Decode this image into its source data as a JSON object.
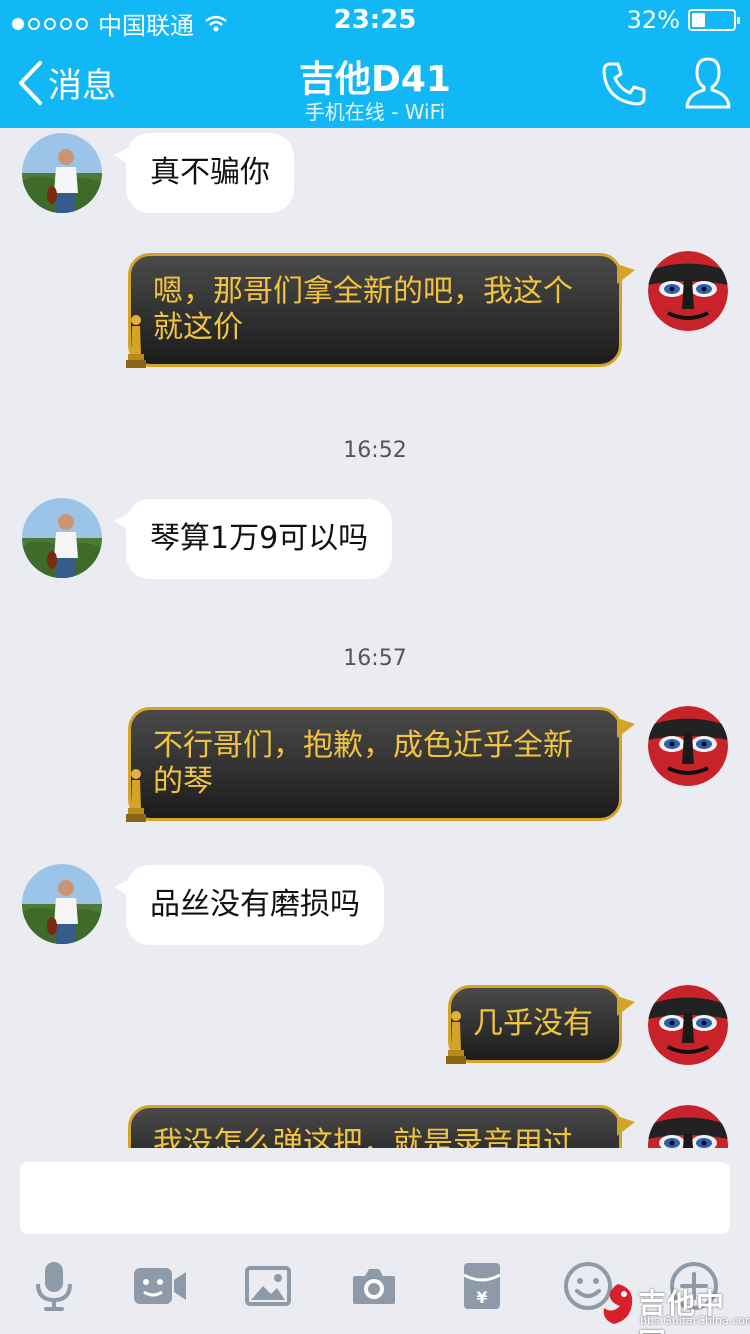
{
  "status_bar": {
    "carrier": "中国联通",
    "time": "23:25",
    "battery": "32%",
    "battery_level": 0.32,
    "signal_dots": 5,
    "signal_filled": 1
  },
  "header": {
    "back_label": "消息",
    "title": "吉他D41",
    "subtitle": "手机在线 - WiFi",
    "accent": "#12b7f5"
  },
  "messages": {
    "m1": "真不骗你",
    "m2": "嗯，那哥们拿全新的吧，我这个就这价",
    "t1": "16:52",
    "m3": "琴算1万9可以吗",
    "t2": "16:57",
    "m4": "不行哥们，抱歉，成色近乎全新的琴",
    "m5": "品丝没有磨损吗",
    "m6": "几乎没有",
    "m7": "我没怎么弹这把，就是录音用过"
  },
  "input": {
    "placeholder": ""
  },
  "toolbar": {
    "icons": [
      "microphone-icon",
      "video-call-icon",
      "image-icon",
      "camera-icon",
      "red-packet-icon",
      "emoji-icon",
      "plus-icon"
    ]
  },
  "watermark": {
    "title": "吉他中国",
    "url": "bbs.GuitarChina.com"
  },
  "colors": {
    "bubble_out_border": "#d4a428",
    "bubble_out_text": "#f2c33e",
    "chat_bg": "#ebecf1"
  }
}
